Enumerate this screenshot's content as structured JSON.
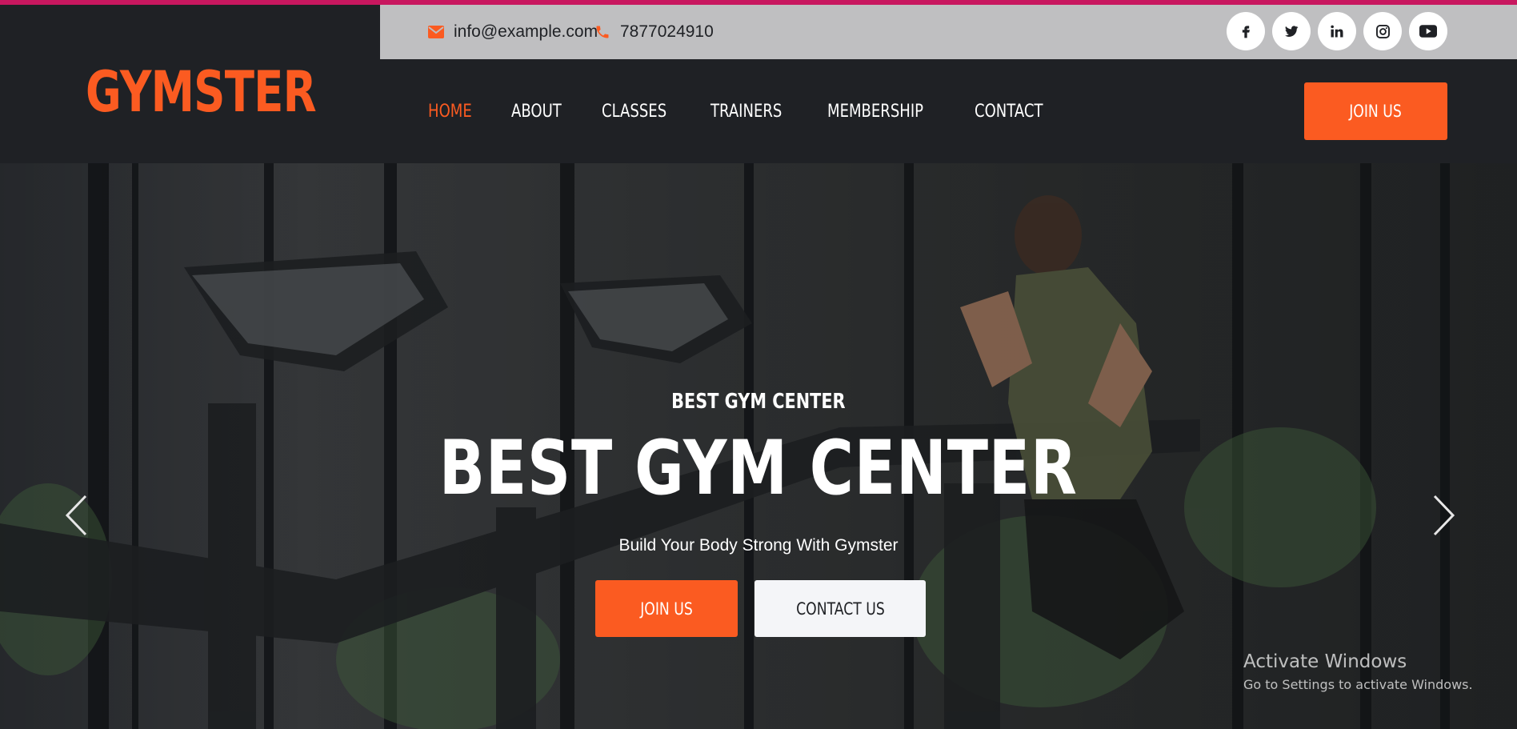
{
  "brand": {
    "logo": "GYMSTER"
  },
  "contact": {
    "email": "info@example.com",
    "email_icon": "envelope-icon",
    "phone": "7877024910",
    "phone_icon": "phone-icon"
  },
  "socials": [
    {
      "name": "facebook-icon"
    },
    {
      "name": "twitter-icon"
    },
    {
      "name": "linkedin-icon"
    },
    {
      "name": "instagram-icon"
    },
    {
      "name": "youtube-icon"
    }
  ],
  "nav": {
    "items": [
      {
        "label": "HOME",
        "active": true
      },
      {
        "label": "ABOUT"
      },
      {
        "label": "CLASSES"
      },
      {
        "label": "TRAINERS"
      },
      {
        "label": "MEMBERSHIP"
      },
      {
        "label": "CONTACT"
      }
    ],
    "cta_label": "JOIN US"
  },
  "hero": {
    "subtitle": "BEST GYM CENTER",
    "title": "BEST GYM CENTER",
    "tagline": "Build Your Body Strong With Gymster",
    "primary_button": "JOIN US",
    "secondary_button": "CONTACT US",
    "prev_icon": "chevron-left-icon",
    "next_icon": "chevron-right-icon"
  },
  "watermark": {
    "title": "Activate Windows",
    "subtitle": "Go to Settings to activate Windows."
  },
  "colors": {
    "accent": "#fb5b21",
    "dark": "#1f2125",
    "infobar": "#bfbfc1",
    "topline": "#c8175f"
  }
}
